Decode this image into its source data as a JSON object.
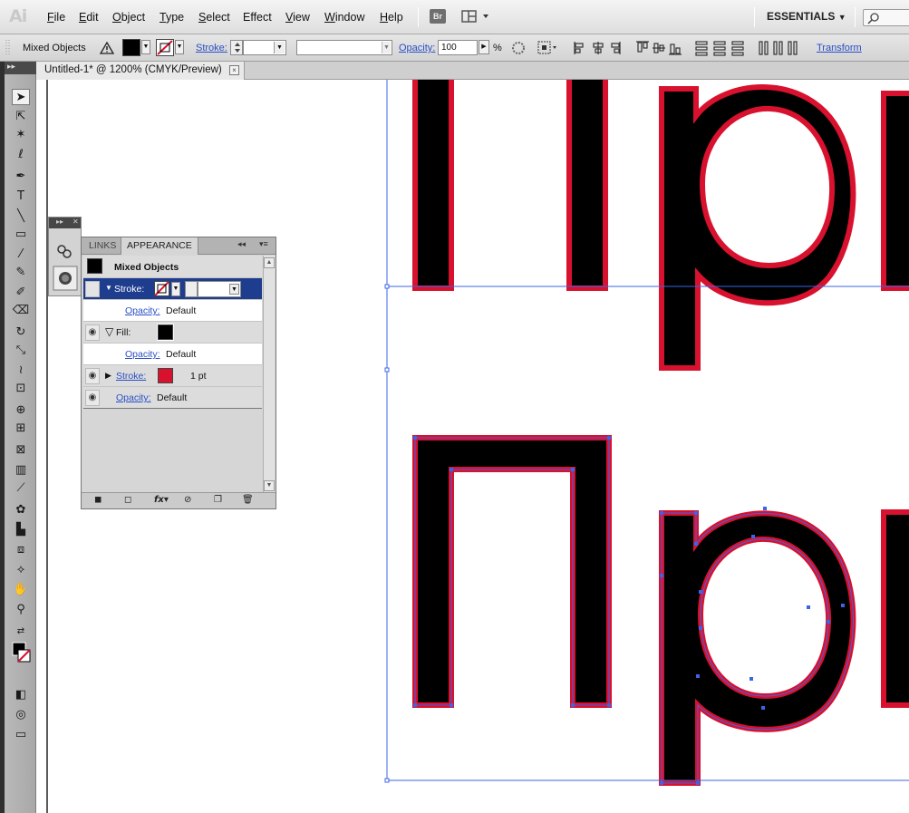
{
  "app": {
    "logo": "Ai"
  },
  "menu": [
    {
      "label": "File",
      "u": "F",
      "rest": "ile"
    },
    {
      "label": "Edit",
      "u": "E",
      "rest": "dit"
    },
    {
      "label": "Object",
      "u": "O",
      "rest": "bject"
    },
    {
      "label": "Type",
      "u": "T",
      "rest": "ype"
    },
    {
      "label": "Select",
      "u": "S",
      "rest": "elect"
    },
    {
      "label": "Effect",
      "u": "",
      "rest": "Effect"
    },
    {
      "label": "View",
      "u": "V",
      "rest": "iew"
    },
    {
      "label": "Window",
      "u": "W",
      "rest": "indow"
    },
    {
      "label": "Help",
      "u": "H",
      "rest": "elp"
    }
  ],
  "bridge_label": "Br",
  "workspace": {
    "label": "ESSENTIALS",
    "arrow": "▼"
  },
  "control": {
    "selection_label": "Mixed Objects",
    "stroke_label": "Stroke:",
    "opacity_label": "Opacity:",
    "opacity_value": "100",
    "opacity_unit": "%",
    "transform_label": "Transform"
  },
  "document_tab": {
    "title": "Untitled-1* @ 1200% (CMYK/Preview)",
    "close": "×"
  },
  "appearance_panel": {
    "tabs": [
      "LINKS",
      "APPEARANCE"
    ],
    "header": "Mixed Objects",
    "rows": [
      {
        "type": "stroke-header",
        "label": "Stroke:"
      },
      {
        "type": "opacity",
        "label": "Opacity:",
        "value": "Default"
      },
      {
        "type": "fill",
        "label": "Fill:"
      },
      {
        "type": "opacity",
        "label": "Opacity:",
        "value": "Default"
      },
      {
        "type": "stroke",
        "label": "Stroke:",
        "value": "1 pt"
      },
      {
        "type": "opacity",
        "label": "Opacity:",
        "value": "Default"
      }
    ],
    "footer_fx": "fx"
  },
  "colors": {
    "stroke_red": "#d8112e",
    "fill_black": "#000000",
    "selection_blue": "#3c64e6",
    "panel_selected": "#1f3d8f"
  },
  "tools": [
    "selection-tool-icon",
    "direct-selection-tool-icon",
    "magic-wand-icon",
    "lasso-icon",
    "pen-tool-icon",
    "type-tool-icon",
    "line-segment-icon",
    "rectangle-tool-icon",
    "paintbrush-icon",
    "pencil-icon",
    "blob-brush-icon",
    "eraser-icon",
    "rotate-tool-icon",
    "scale-tool-icon",
    "warp-tool-icon",
    "free-transform-icon",
    "shape-builder-icon",
    "perspective-grid-icon",
    "mesh-tool-icon",
    "gradient-tool-icon",
    "eyedropper-icon",
    "symbol-sprayer-icon",
    "column-graph-icon",
    "artboard-tool-icon",
    "slice-tool-icon",
    "hand-tool-icon",
    "zoom-tool-icon"
  ]
}
